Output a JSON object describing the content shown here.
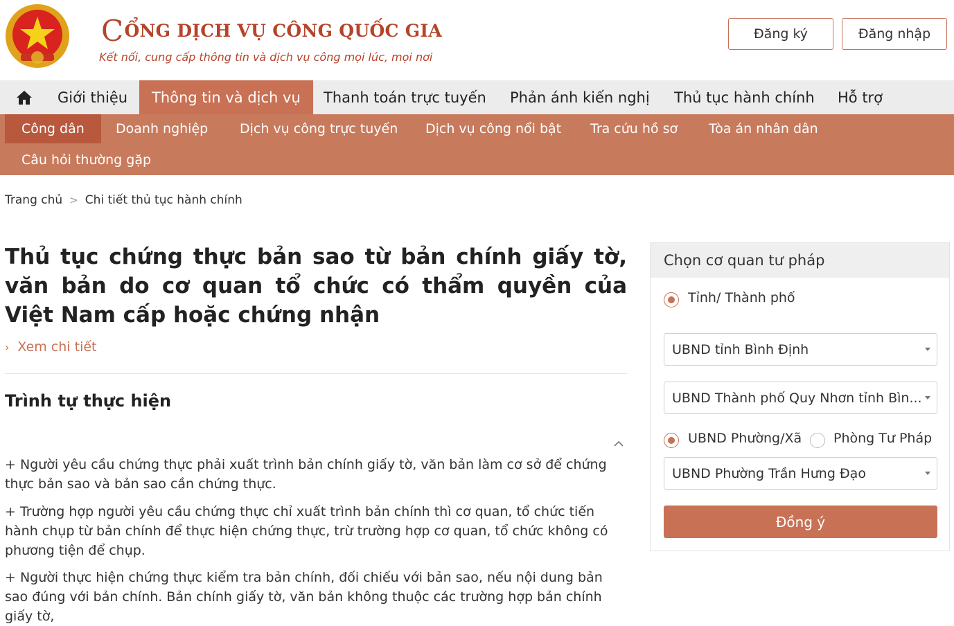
{
  "header": {
    "emblem_icon": "national-emblem-icon",
    "title_initial": "C",
    "title_rest": "ỔNG DỊCH VỤ CÔNG QUỐC GIA",
    "subtitle": "Kết nối, cung cấp thông tin và dịch vụ công mọi lúc, mọi nơi",
    "register_label": "Đăng ký",
    "login_label": "Đăng nhập"
  },
  "main_nav": {
    "home_icon": "home-icon",
    "items": [
      {
        "label": "Giới thiệu"
      },
      {
        "label": "Thông tin và dịch vụ",
        "active": true
      },
      {
        "label": "Thanh toán trực tuyến"
      },
      {
        "label": "Phản ánh kiến nghị"
      },
      {
        "label": "Thủ tục hành chính"
      },
      {
        "label": "Hỗ trợ"
      }
    ]
  },
  "sub_nav": {
    "items": [
      {
        "label": "Công dân",
        "active": true
      },
      {
        "label": "Doanh nghiệp"
      },
      {
        "label": "Dịch vụ công trực tuyến"
      },
      {
        "label": "Dịch vụ công nổi bật"
      },
      {
        "label": "Tra cứu hồ sơ"
      },
      {
        "label": "Tòa án nhân dân"
      },
      {
        "label": "Câu hỏi thường gặp"
      }
    ]
  },
  "breadcrumb": {
    "home": "Trang chủ",
    "separator": ">",
    "current": "Chi tiết thủ tục hành chính"
  },
  "content": {
    "title": "Thủ tục chứng thực bản sao từ bản chính giấy tờ, văn bản do cơ quan tổ chức có thẩm quyền của Việt Nam cấp hoặc chứng nhận",
    "more_link": "Xem chi tiết",
    "section_title": "Trình tự thực hiện",
    "paragraphs": [
      "+ Người yêu cầu chứng thực phải xuất trình bản chính giấy tờ, văn bản làm cơ sở để chứng thực bản sao và bản sao cần chứng thực.",
      "+ Trường hợp người yêu cầu chứng thực chỉ xuất trình bản chính thì cơ quan, tổ chức tiến hành chụp từ bản chính để thực hiện chứng thực, trừ trường hợp cơ quan, tổ chức không có phương tiện để chụp.",
      "+ Người thực hiện chứng thực kiểm tra bản chính, đối chiếu với bản sao, nếu nội dung bản sao đúng với bản chính. Bản chính giấy tờ, văn bản không thuộc các trường hợp bản chính giấy tờ,"
    ]
  },
  "panel": {
    "heading": "Chọn cơ quan tư pháp",
    "radio_province": "Tỉnh/ Thành phố",
    "select_province": "UBND tỉnh Bình Định",
    "select_district": "UBND Thành phố Quy Nhơn tỉnh Bìn...",
    "radio_ward": "UBND Phường/Xã",
    "radio_justice": "Phòng Tư Pháp",
    "select_ward": "UBND Phường Trần Hưng Đạo",
    "submit_label": "Đồng ý"
  },
  "colors": {
    "brand": "#b5442a",
    "accent": "#c87154",
    "subnav_bg": "#c87a5c",
    "mainnav_bg": "#ececec"
  }
}
